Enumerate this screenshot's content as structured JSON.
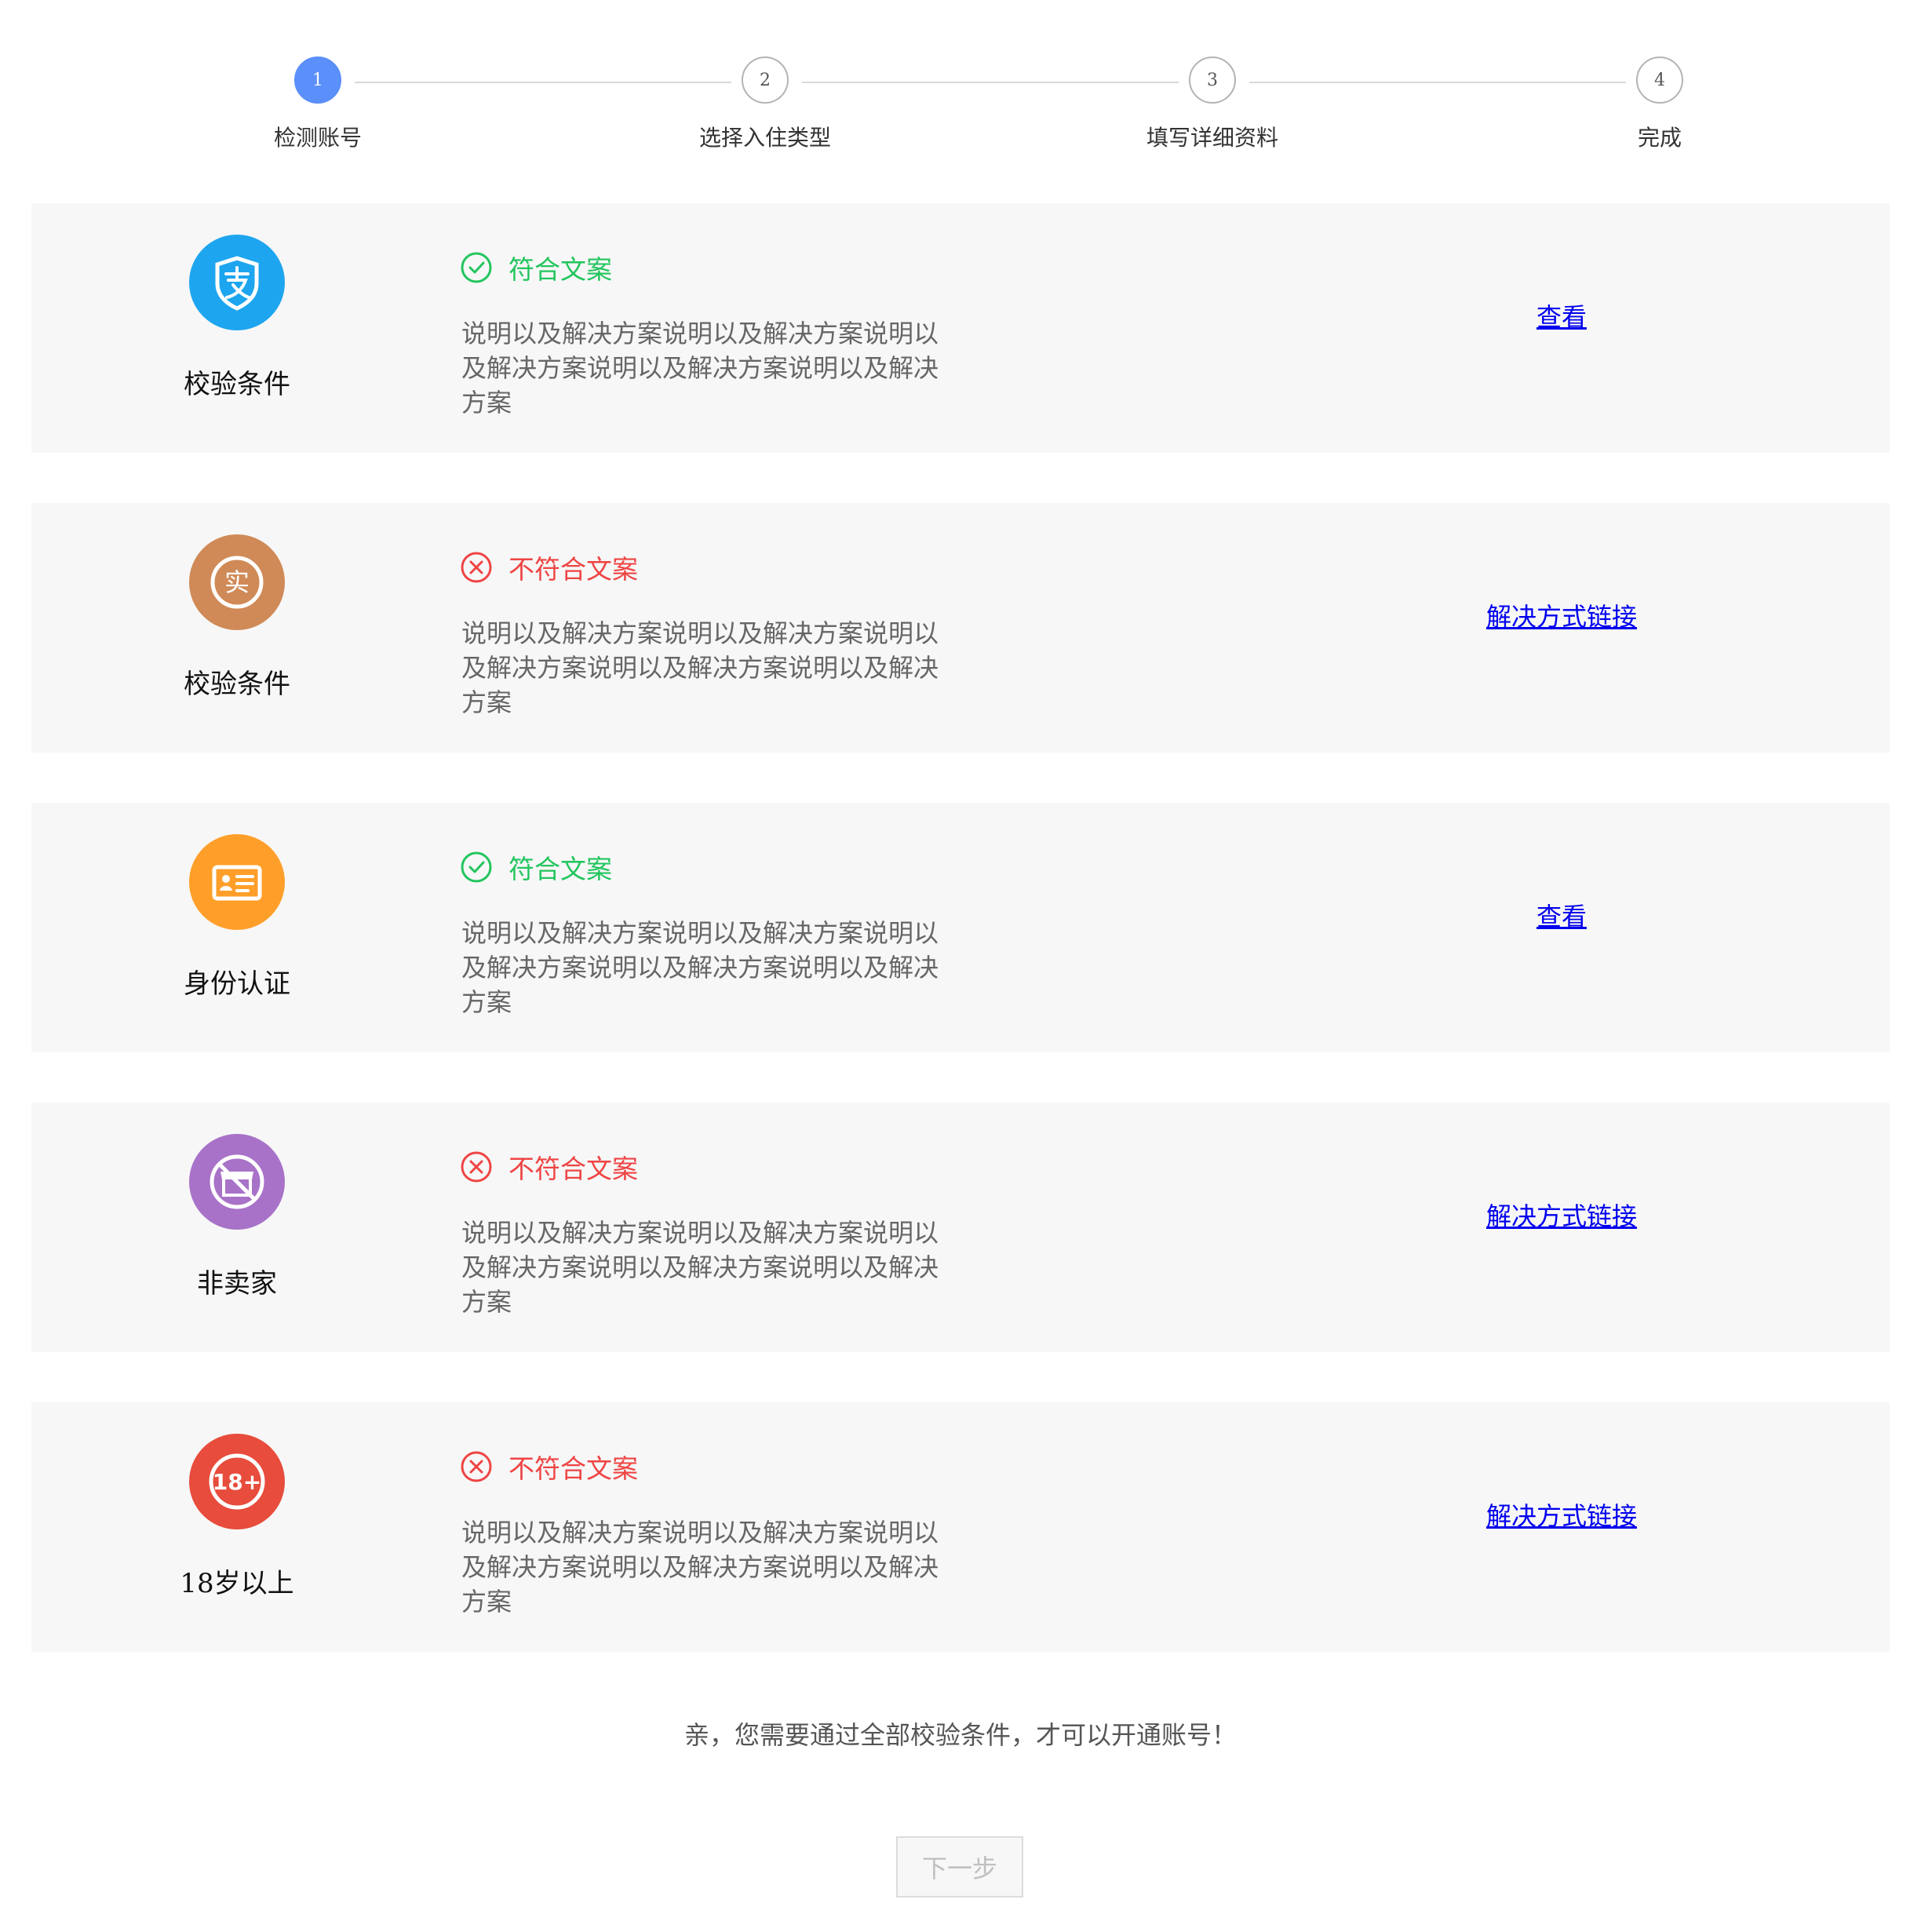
{
  "steps": [
    {
      "number": "1",
      "label": "检测账号",
      "active": true
    },
    {
      "number": "2",
      "label": "选择入住类型",
      "active": false
    },
    {
      "number": "3",
      "label": "填写详细资料",
      "active": false
    },
    {
      "number": "4",
      "label": "完成",
      "active": false
    }
  ],
  "conditions": [
    {
      "icon": "alipay-icon",
      "icon_color": "#1ea5ef",
      "name": "校验条件",
      "status": "ok",
      "status_text": "符合文案",
      "description": "说明以及解决方案说明以及解决方案说明以及解决方案说明以及解决方案说明以及解决方案",
      "action": "查看"
    },
    {
      "icon": "real-name-icon",
      "icon_color": "#d08a57",
      "name": "校验条件",
      "status": "bad",
      "status_text": "不符合文案",
      "description": "说明以及解决方案说明以及解决方案说明以及解决方案说明以及解决方案说明以及解决方案",
      "action": "解决方式链接"
    },
    {
      "icon": "id-card-icon",
      "icon_color": "#ff9f2a",
      "name": "身份认证",
      "status": "ok",
      "status_text": "符合文案",
      "description": "说明以及解决方案说明以及解决方案说明以及解决方案说明以及解决方案说明以及解决方案",
      "action": "查看"
    },
    {
      "icon": "no-shop-icon",
      "icon_color": "#a872c8",
      "name": "非卖家",
      "status": "bad",
      "status_text": "不符合文案",
      "description": "说明以及解决方案说明以及解决方案说明以及解决方案说明以及解决方案说明以及解决方案",
      "action": "解决方式链接"
    },
    {
      "icon": "age-18-plus-icon",
      "icon_color": "#e74c3c",
      "name": "18岁以上",
      "status": "bad",
      "status_text": "不符合文案",
      "description": "说明以及解决方案说明以及解决方案说明以及解决方案说明以及解决方案说明以及解决方案",
      "action": "解决方式链接"
    }
  ],
  "icon_badge": {
    "real_name": "实",
    "age": "18+"
  },
  "colors": {
    "ok": "#22c55e",
    "bad": "#ef4444",
    "step_active": "#5b8ff9"
  },
  "notice": "亲，您需要通过全部校验条件，才可以开通账号！",
  "next_button": "下一步"
}
